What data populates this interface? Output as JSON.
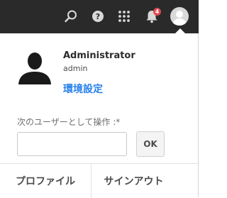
{
  "topbar": {
    "icons": [
      "search-icon",
      "help-icon",
      "apps-grid-icon",
      "bell-icon",
      "user-avatar-icon"
    ],
    "notification_count": "4",
    "background_color": "#2a2a2a",
    "badge_color": "#e34850"
  },
  "user": {
    "name": "Administrator",
    "id": "admin",
    "preferences_link": "環境設定"
  },
  "impersonate": {
    "label": "次のユーザーとして操作 :*",
    "input_value": "",
    "ok_label": "OK"
  },
  "footer": {
    "profile_label": "プロファイル",
    "signout_label": "サインアウト"
  },
  "colors": {
    "link": "#2680eb"
  }
}
